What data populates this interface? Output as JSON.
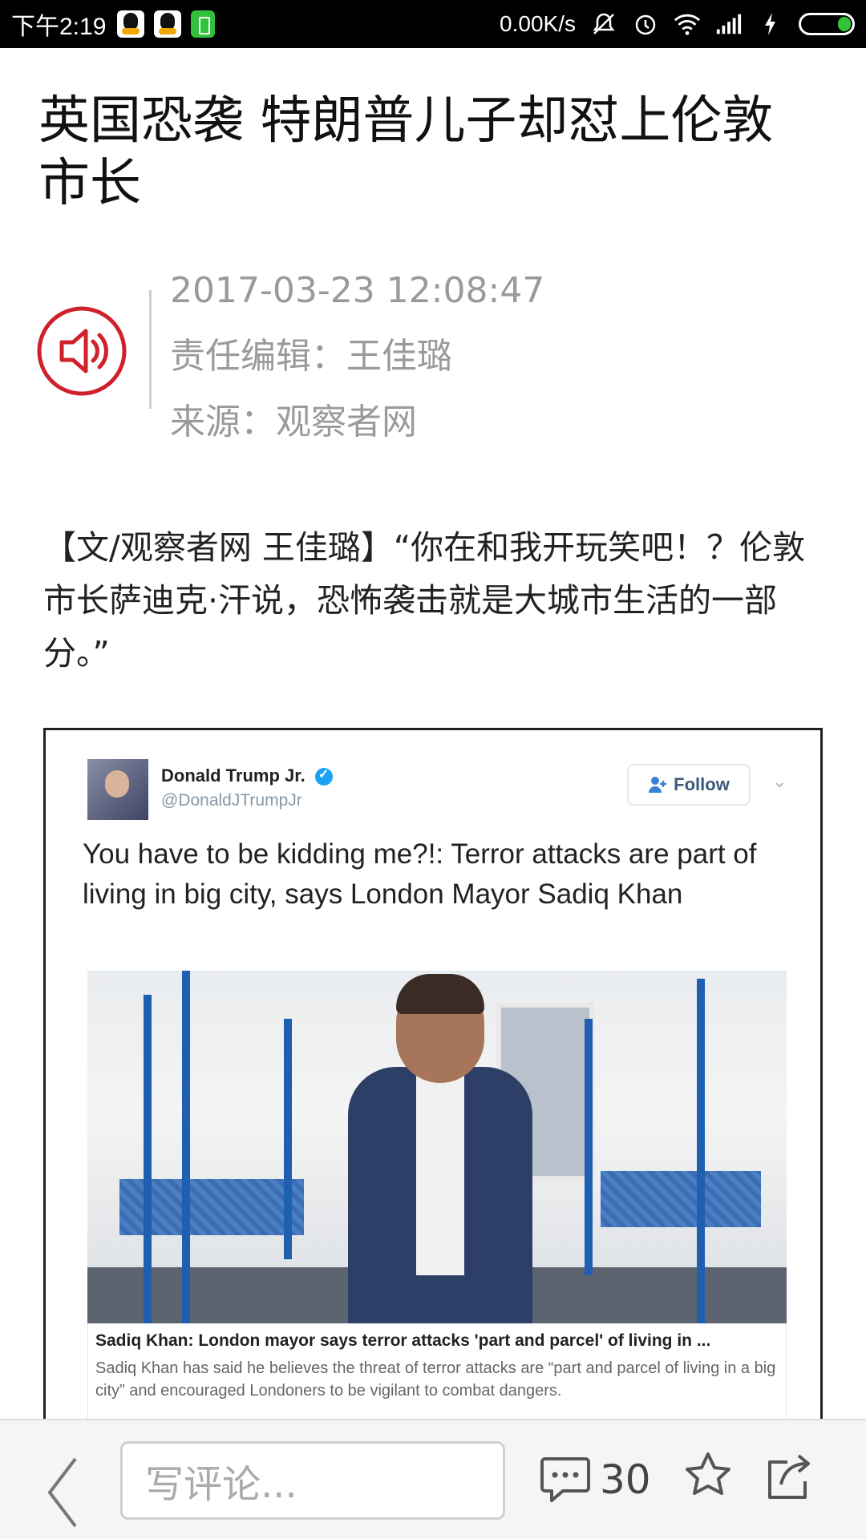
{
  "status_bar": {
    "time": "下午2:19",
    "speed": "0.00K/s"
  },
  "article": {
    "title": "英国恐袭 特朗普儿子却怼上伦敦市长",
    "date": "2017-03-23 12:08:47",
    "editor": "责任编辑：王佳璐",
    "source": "来源：观察者网",
    "paragraph": "【文/观察者网 王佳璐】“你在和我开玩笑吧！？伦敦市长萨迪克·汗说，恐怖袭击就是大城市生活的一部分。”",
    "accent_color": "#d0202a"
  },
  "tweet": {
    "name": "Donald Trump Jr.",
    "handle": "@DonaldJTrumpJr",
    "follow_label": "Follow",
    "text": "You have to be kidding me?!: Terror attacks are part of living in big city, says London Mayor Sadiq Khan",
    "card_title": "Sadiq Khan: London mayor says terror attacks 'part and parcel' of living in ...",
    "card_desc": "Sadiq Khan has said he believes the threat of terror attacks are “part and parcel of living in a big city” and encouraged Londoners to be vigilant to combat dangers."
  },
  "bottom_bar": {
    "comment_placeholder": "写评论...",
    "comment_count": "30"
  }
}
